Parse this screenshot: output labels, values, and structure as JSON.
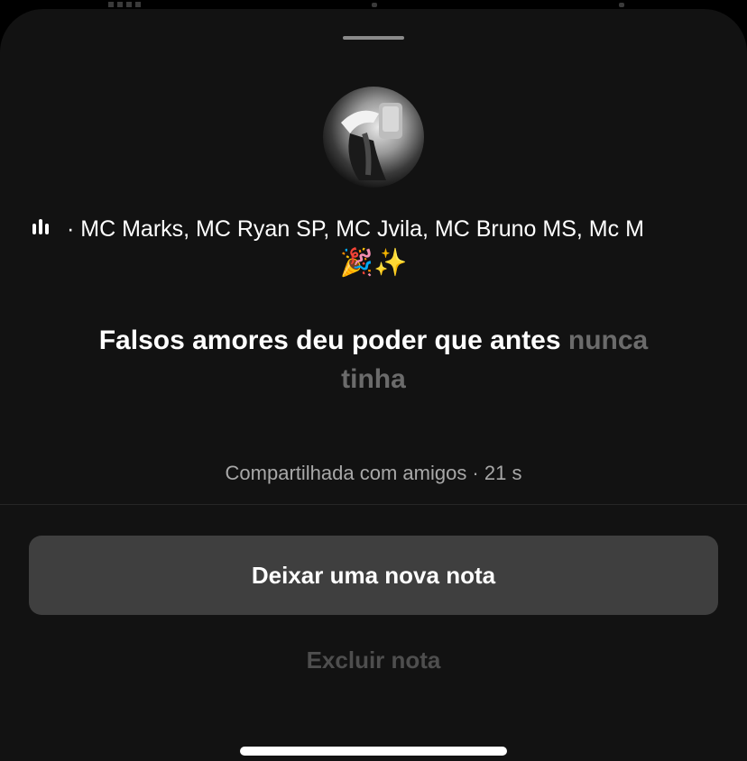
{
  "sheet": {
    "background": "#121212"
  },
  "avatar": {
    "icon": "user-avatar"
  },
  "music": {
    "icon": "audio-wave-icon",
    "title": "· MC Marks, MC Ryan SP, MC Jvila, MC Bruno MS, Mc M",
    "emoji": "🎉✨"
  },
  "note": {
    "text_main": "Falsos amores deu poder que antes ",
    "text_faded": "nunca tinha"
  },
  "meta": {
    "shared": "Compartilhada com amigos · 21 s"
  },
  "actions": {
    "new_note_label": "Deixar uma nova nota",
    "delete_label": "Excluir nota",
    "primary_bg": "#3f3f3f",
    "delete_color": "#4e4e4e"
  }
}
